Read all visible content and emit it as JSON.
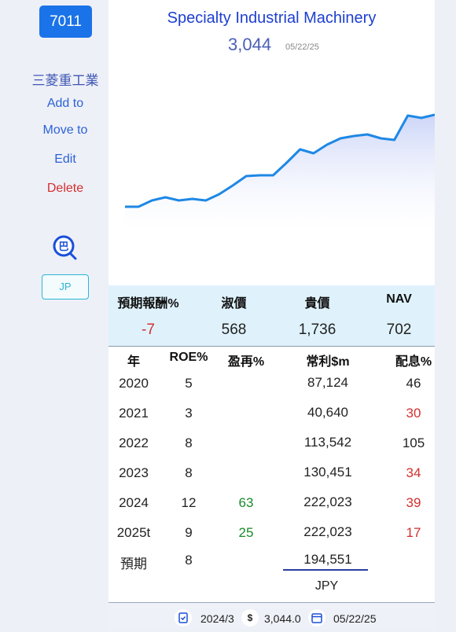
{
  "sidebar": {
    "code": "7011",
    "company": "三菱重工業",
    "links": [
      "Add to",
      "Move to",
      "Edit",
      "Delete"
    ],
    "market_button": "JP",
    "search_icon_glyph": "巴"
  },
  "header": {
    "title": "Specialty Industrial Machinery",
    "price": "3,044",
    "date": "05/22/25"
  },
  "chart_data": {
    "type": "area",
    "values": [
      263,
      263,
      255,
      251,
      255,
      253,
      255,
      247,
      236,
      224,
      223,
      223,
      207,
      190,
      195,
      184,
      176,
      173,
      171,
      176,
      178,
      147,
      150,
      146
    ],
    "inverted_scale_note": "",
    "line_color": "#1e88e5",
    "fill_color": "#c9d3f7"
  },
  "band": {
    "headers": [
      "預期報酬%",
      "淑價",
      "貴價",
      "NAV"
    ],
    "values": [
      "-7",
      "568",
      "1,736",
      "702"
    ]
  },
  "table": {
    "headers": [
      "年",
      "ROE%",
      "盈再%",
      "常利$m",
      "配息%"
    ],
    "rows": [
      [
        "2020",
        "5",
        "",
        "87,124",
        "46"
      ],
      [
        "2021",
        "3",
        "",
        "40,640",
        "30"
      ],
      [
        "2022",
        "8",
        "",
        "113,542",
        "105"
      ],
      [
        "2023",
        "8",
        "",
        "130,451",
        "34"
      ],
      [
        "2024",
        "12",
        "63",
        "222,023",
        "39"
      ],
      [
        "2025t",
        "9",
        "25",
        "222,023",
        "17"
      ],
      [
        "預期",
        "8",
        "",
        "194,551",
        ""
      ]
    ],
    "currency": "JPY"
  },
  "footer": {
    "period": "2024/3",
    "price": "3,044.0",
    "date": "05/22/25",
    "dollar_glyph": "$"
  },
  "colors": {
    "accent": "#1a73e8",
    "negative": "#d32f2f",
    "positive": "#1a8a2a"
  }
}
